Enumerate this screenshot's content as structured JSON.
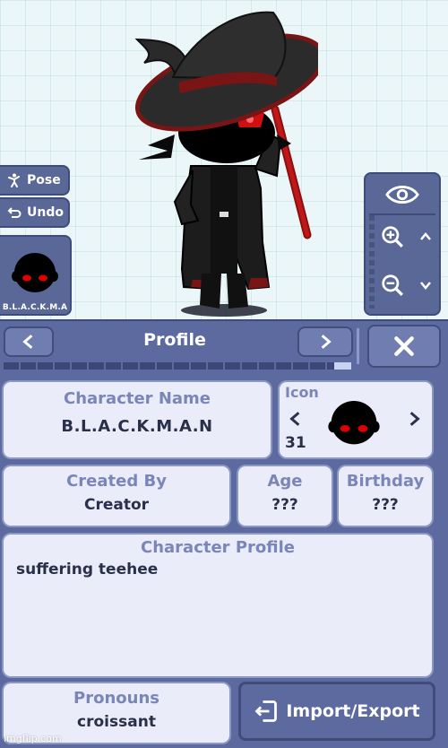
{
  "stage": {
    "pose_label": "Pose",
    "undo_label": "Undo",
    "character_slot_label": "B.L.A.C.K.M.A"
  },
  "profile": {
    "title": "Profile",
    "progress": 0.05,
    "character_name_label": "Character Name",
    "character_name": "B.L.A.C.K.M.A.N",
    "icon_label": "Icon",
    "icon_number": "31",
    "created_by_label": "Created By",
    "created_by": "Creator",
    "age_label": "Age",
    "age": "???",
    "birthday_label": "Birthday",
    "birthday": "???",
    "character_profile_label": "Character Profile",
    "character_profile": "suffering teehee",
    "pronouns_label": "Pronouns",
    "pronouns": "croissant",
    "import_export_label": "Import/Export"
  },
  "watermark": "imgflip.com",
  "colors": {
    "panel": "#5c6a9f",
    "card": "#eaedf9",
    "label": "#7a85b8",
    "accent_red": "#d01010"
  }
}
